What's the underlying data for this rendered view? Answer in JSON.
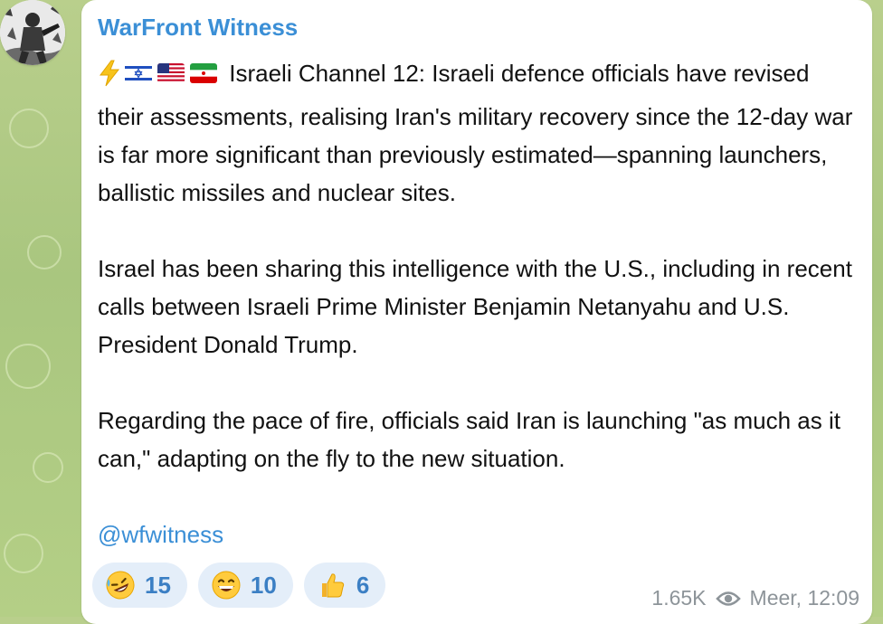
{
  "channel": {
    "name": "WarFront Witness",
    "avatar_icon": "soldier-avatar-icon"
  },
  "message": {
    "lead_icons": [
      "lightning-icon",
      "israel-flag-icon",
      "usa-flag-icon",
      "iran-flag-icon"
    ],
    "lead_line": "Israeli Channel 12: Israeli defence officials have revised",
    "paragraph1_rest": "their assessments, realising Iran's military recovery since the 12-day war is far more significant than previously estimated—spanning launchers, ballistic missiles and nuclear sites.",
    "paragraph2": "Israel has been sharing this intelligence with the U.S., including in recent calls between Israeli Prime Minister Benjamin Netanyahu and U.S. President Donald Trump.",
    "paragraph3": "Regarding the pace of fire, officials said Iran is launching \"as much as it can,\" adapting on the fly to the new situation.",
    "handle": "@wfwitness"
  },
  "reactions": [
    {
      "icon": "rofl-emoji-icon",
      "count": "15"
    },
    {
      "icon": "grin-emoji-icon",
      "count": "10"
    },
    {
      "icon": "thumbs-up-emoji-icon",
      "count": "6"
    }
  ],
  "footer": {
    "views": "1.65K",
    "views_icon": "eye-icon",
    "time": "Meer, 12:09"
  },
  "colors": {
    "accent": "#3b8fd6",
    "reaction_bg": "#e4eef9",
    "meta_text": "#8d9499",
    "wallpaper": "#b2cc85"
  }
}
